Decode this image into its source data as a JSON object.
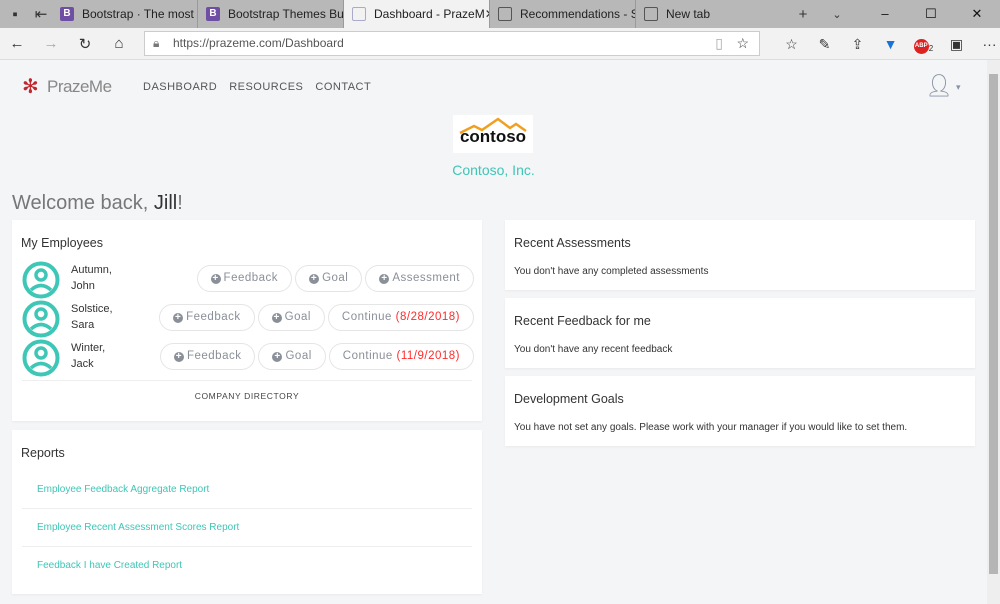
{
  "browser": {
    "tabs": [
      {
        "title": "Bootstrap · The most pop",
        "icon": "B"
      },
      {
        "title": "Bootstrap Themes Built &",
        "icon": "B"
      },
      {
        "title": "Dashboard - PrazeM",
        "active": true
      },
      {
        "title": "Recommendations - See"
      },
      {
        "title": "New tab"
      }
    ],
    "url": "https://prazeme.com/Dashboard",
    "extension_badge": "2"
  },
  "nav": {
    "brand": "PrazeMe",
    "items": [
      "DASHBOARD",
      "RESOURCES",
      "CONTACT"
    ]
  },
  "company": {
    "logo_text": "contoso",
    "name": "Contoso, Inc."
  },
  "welcome": {
    "prefix": "Welcome back, ",
    "name": "Jill",
    "suffix": "!"
  },
  "employees": {
    "title": "My Employees",
    "rows": [
      {
        "last": "Autumn,",
        "first": "John",
        "b1": "Feedback",
        "b2": "Goal",
        "b3": "Assessment",
        "date": ""
      },
      {
        "last": "Solstice,",
        "first": "Sara",
        "b1": "Feedback",
        "b2": "Goal",
        "b3": "Continue",
        "date": "(8/28/2018)"
      },
      {
        "last": "Winter,",
        "first": "Jack",
        "b1": "Feedback",
        "b2": "Goal",
        "b3": "Continue",
        "date": "(11/9/2018)"
      }
    ],
    "directory": "COMPANY DIRECTORY"
  },
  "reports": {
    "title": "Reports",
    "items": [
      "Employee Feedback Aggregate Report",
      "Employee Recent Assessment Scores Report",
      "Feedback I have Created Report"
    ]
  },
  "assessments": {
    "title": "Recent Assessments",
    "text": "You don't have any completed assessments"
  },
  "feedback": {
    "title": "Recent Feedback for me",
    "text": "You don't have any recent feedback"
  },
  "goals": {
    "title": "Development Goals",
    "text": "You have not set any goals. Please work with your manager if you would like to set them."
  },
  "colors": {
    "accent": "#3ec6b6",
    "date": "#ff2b2b"
  }
}
